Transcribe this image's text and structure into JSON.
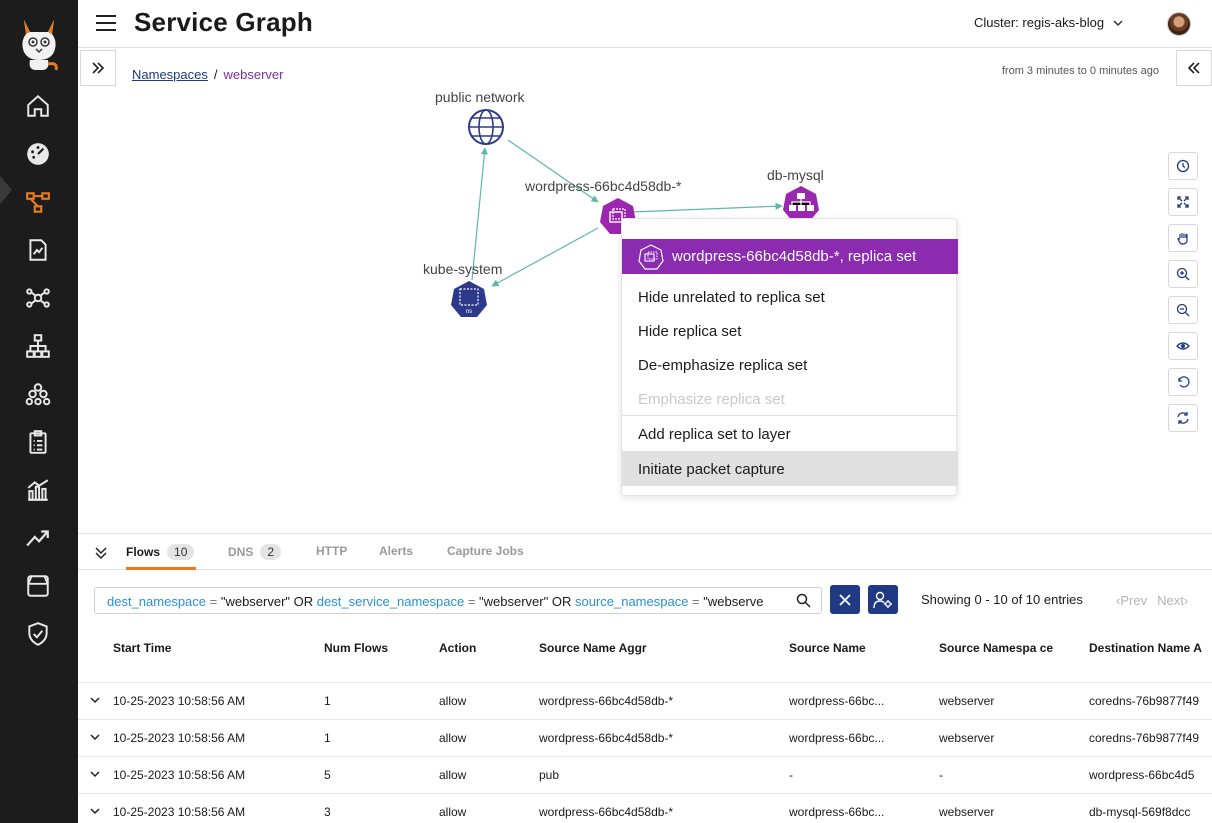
{
  "header": {
    "title": "Service Graph",
    "cluster_label": "Cluster: regis-aks-blog"
  },
  "sidebar": {
    "items": [
      {
        "name": "home-icon"
      },
      {
        "name": "dashboard-icon"
      },
      {
        "name": "service-graph-icon",
        "active": true
      },
      {
        "name": "policies-icon"
      },
      {
        "name": "endpoints-icon"
      },
      {
        "name": "network-sets-icon"
      },
      {
        "name": "namespaces-icon"
      },
      {
        "name": "compliance-icon"
      },
      {
        "name": "reports-icon"
      },
      {
        "name": "activity-icon"
      },
      {
        "name": "managed-clusters-icon"
      },
      {
        "name": "security-icon"
      }
    ]
  },
  "graph": {
    "breadcrumb": {
      "root": "Namespaces",
      "sep": "/",
      "current": "webserver"
    },
    "time_range": "from 3 minutes to 0 minutes ago",
    "nodes": {
      "public_network": "public network",
      "wordpress": "wordpress-66bc4d58db-*",
      "db_mysql": "db-mysql",
      "kube_system": "kube-system",
      "ns_badge": "ns"
    }
  },
  "context_menu": {
    "header": "wordpress-66bc4d58db-*, replica set",
    "items": [
      {
        "label": "Hide unrelated to replica set",
        "enabled": true
      },
      {
        "label": "Hide replica set",
        "enabled": true
      },
      {
        "label": "De-emphasize replica set",
        "enabled": true
      },
      {
        "label": "Emphasize replica set",
        "enabled": false
      },
      {
        "label": "Add replica set to layer",
        "enabled": true
      },
      {
        "label": "Initiate packet capture",
        "enabled": true,
        "highlighted": true
      }
    ]
  },
  "tabs": [
    {
      "label": "Flows",
      "count": "10",
      "active": true
    },
    {
      "label": "DNS",
      "count": "2"
    },
    {
      "label": "HTTP"
    },
    {
      "label": "Alerts"
    },
    {
      "label": "Capture Jobs"
    }
  ],
  "filter": {
    "k1": "dest_namespace",
    "op1": " = ",
    "v1": "\"webserver\"",
    "or1": " OR ",
    "k2": "dest_service_namespace",
    "op2": " = ",
    "v2": "\"webserver\"",
    "or2": " OR ",
    "k3": "source_namespace",
    "op3": " = ",
    "v3": "\"webserve"
  },
  "showing": "Showing 0 - 10 of 10 entries",
  "pager": {
    "prev": "Prev",
    "next": "Next"
  },
  "table": {
    "columns": [
      "Start Time",
      "Num Flows",
      "Action",
      "Source Name Aggr",
      "Source Name",
      "Source Namespa ce",
      "Destination Name A"
    ],
    "rows": [
      [
        "10-25-2023 10:58:56 AM",
        "1",
        "allow",
        "wordpress-66bc4d58db-*",
        "wordpress-66bc...",
        "webserver",
        "coredns-76b9877f49"
      ],
      [
        "10-25-2023 10:58:56 AM",
        "1",
        "allow",
        "wordpress-66bc4d58db-*",
        "wordpress-66bc...",
        "webserver",
        "coredns-76b9877f49"
      ],
      [
        "10-25-2023 10:58:56 AM",
        "5",
        "allow",
        "pub",
        "-",
        "-",
        "wordpress-66bc4d5"
      ],
      [
        "10-25-2023 10:58:56 AM",
        "3",
        "allow",
        "wordpress-66bc4d58db-*",
        "wordpress-66bc...",
        "webserver",
        "db-mysql-569f8dcc"
      ]
    ]
  },
  "colors": {
    "accent": "#8a2bb0",
    "brand_orange": "#e87b1e",
    "navy": "#1f3a82",
    "node_blue": "#2d3a8c"
  }
}
